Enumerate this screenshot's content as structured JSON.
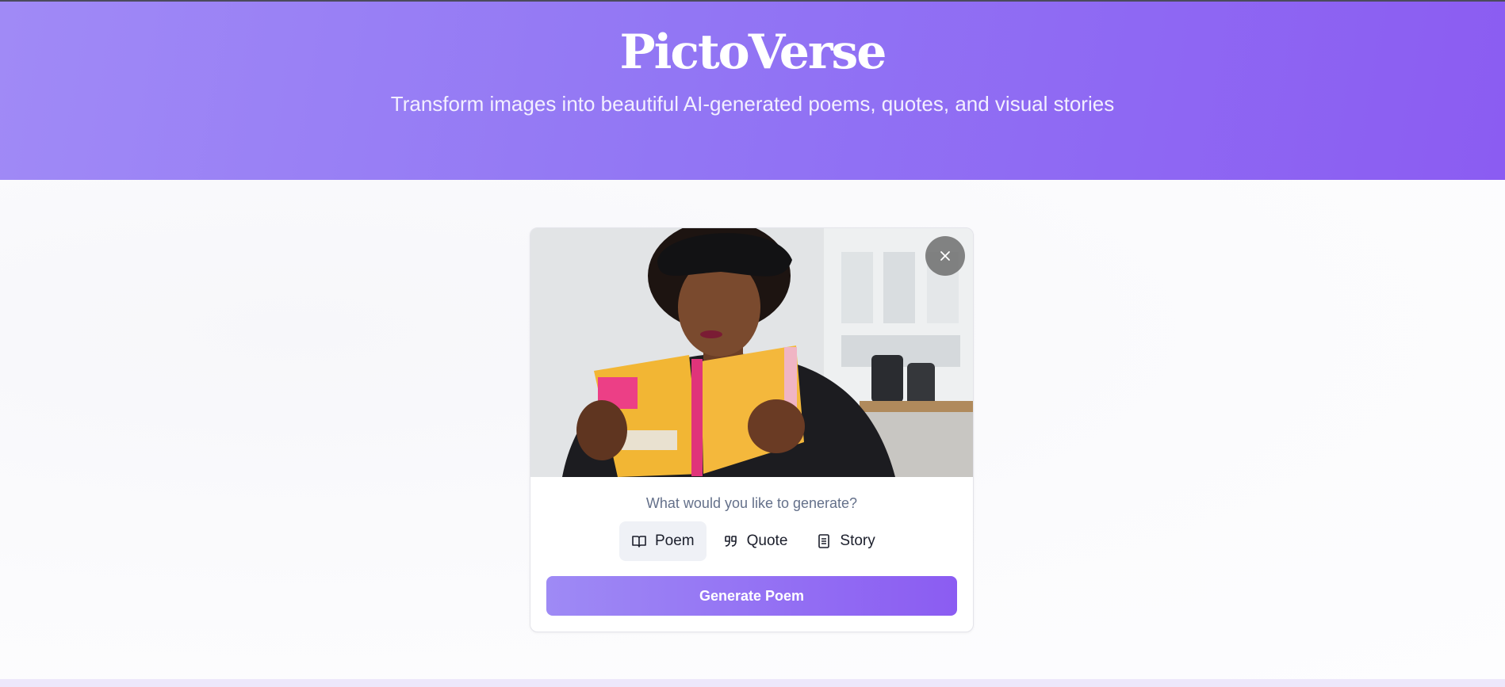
{
  "app": {
    "title": "PictoVerse",
    "tagline": "Transform images into beautiful AI-generated poems, quotes, and visual stories"
  },
  "colors": {
    "accent_start": "#a08af6",
    "accent_end": "#8b5cf2"
  },
  "upload_card": {
    "image_description_icon": "uploaded-photo",
    "close_icon": "close-icon",
    "prompt": "What would you like to generate?",
    "types": [
      {
        "label": "Poem",
        "icon": "book-open-icon",
        "selected": true
      },
      {
        "label": "Quote",
        "icon": "quote-icon",
        "selected": false
      },
      {
        "label": "Story",
        "icon": "document-icon",
        "selected": false
      }
    ],
    "generate_label": "Generate Poem"
  }
}
